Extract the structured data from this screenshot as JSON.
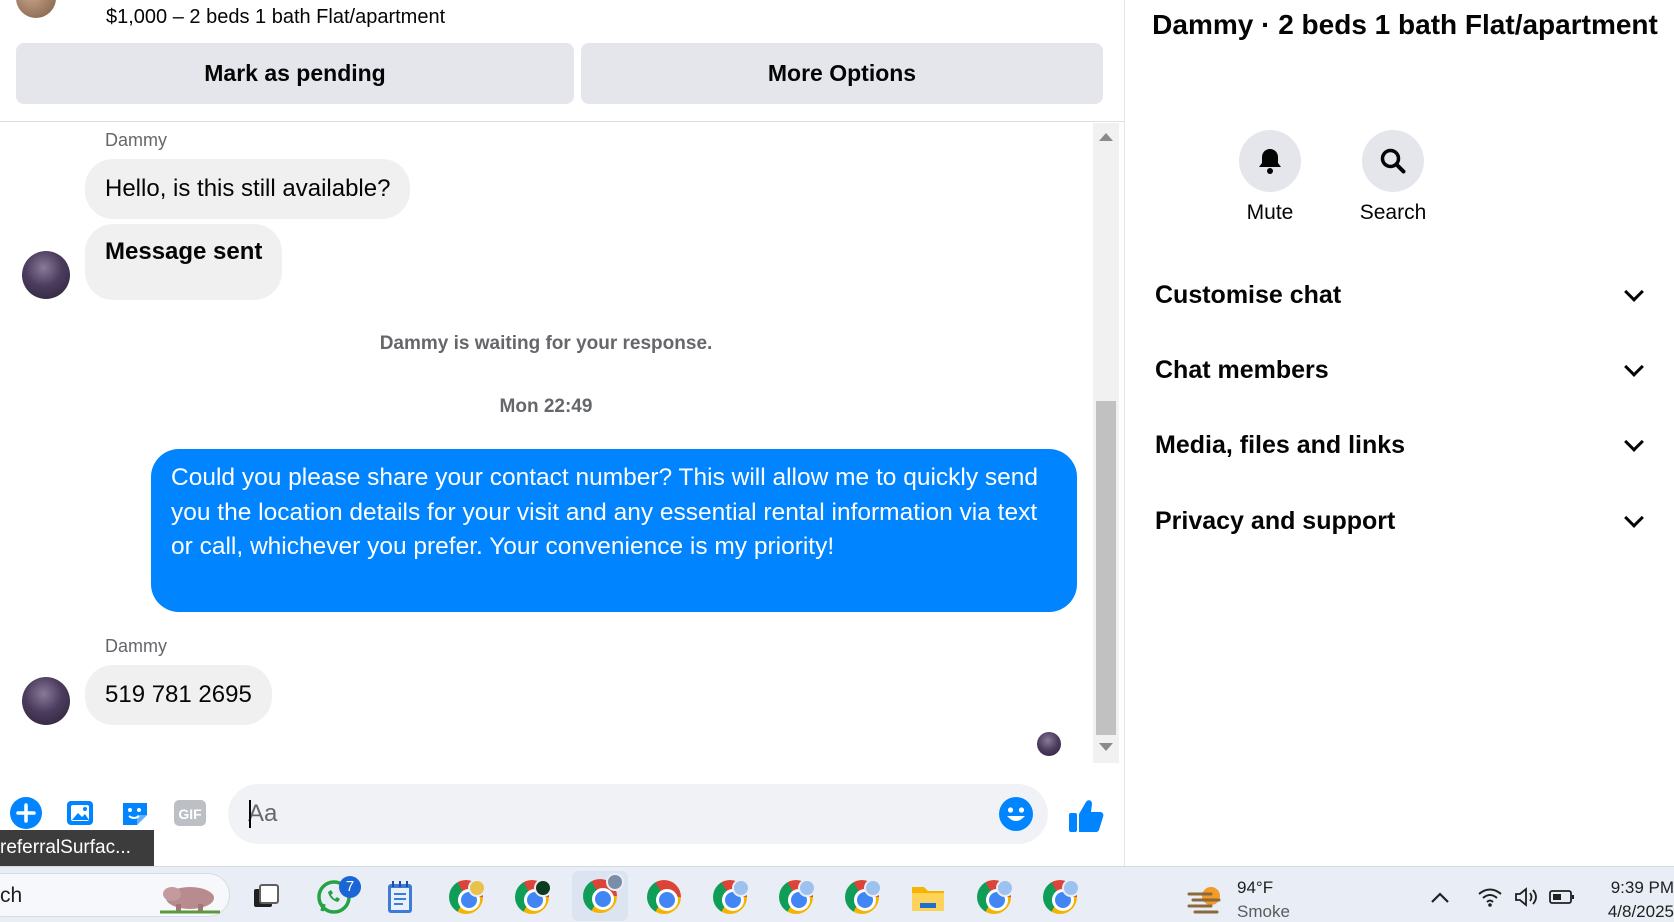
{
  "listing": {
    "subtitle": "$1,000 – 2 beds 1 bath Flat/apartment",
    "mark_pending_label": "Mark as pending",
    "more_options_label": "More Options"
  },
  "messages": {
    "sender_1": "Dammy",
    "msg_1": "Hello, is this still available?",
    "msg_2": "Message sent",
    "waiting_note": "Dammy is waiting for your response.",
    "timestamp": "Mon 22:49",
    "outgoing": "Could you please share your contact number? This will allow me to quickly send you the location details for your visit and any essential rental information via text or call, whichever you prefer. Your convenience is my priority!",
    "sender_2": "Dammy",
    "msg_3": "519 781 2695"
  },
  "composer": {
    "placeholder": "Aa",
    "gif_label": "GIF"
  },
  "tooltip": "referralSurfac...",
  "info": {
    "title": "Dammy · 2 beds 1 bath Flat/apartment",
    "mute_label": "Mute",
    "search_label": "Search",
    "sections": [
      "Customise chat",
      "Chat members",
      "Media, files and links",
      "Privacy and support"
    ]
  },
  "taskbar": {
    "search_text": "ch",
    "whatsapp_badge": "7",
    "weather_temp": "94°F",
    "weather_desc": "Smoke",
    "time": "9:39 PM",
    "date": "4/8/2025"
  },
  "colors": {
    "accent": "#0084ff",
    "bubble_in": "#f0f0f0",
    "button_bg": "#e4e6eb"
  }
}
